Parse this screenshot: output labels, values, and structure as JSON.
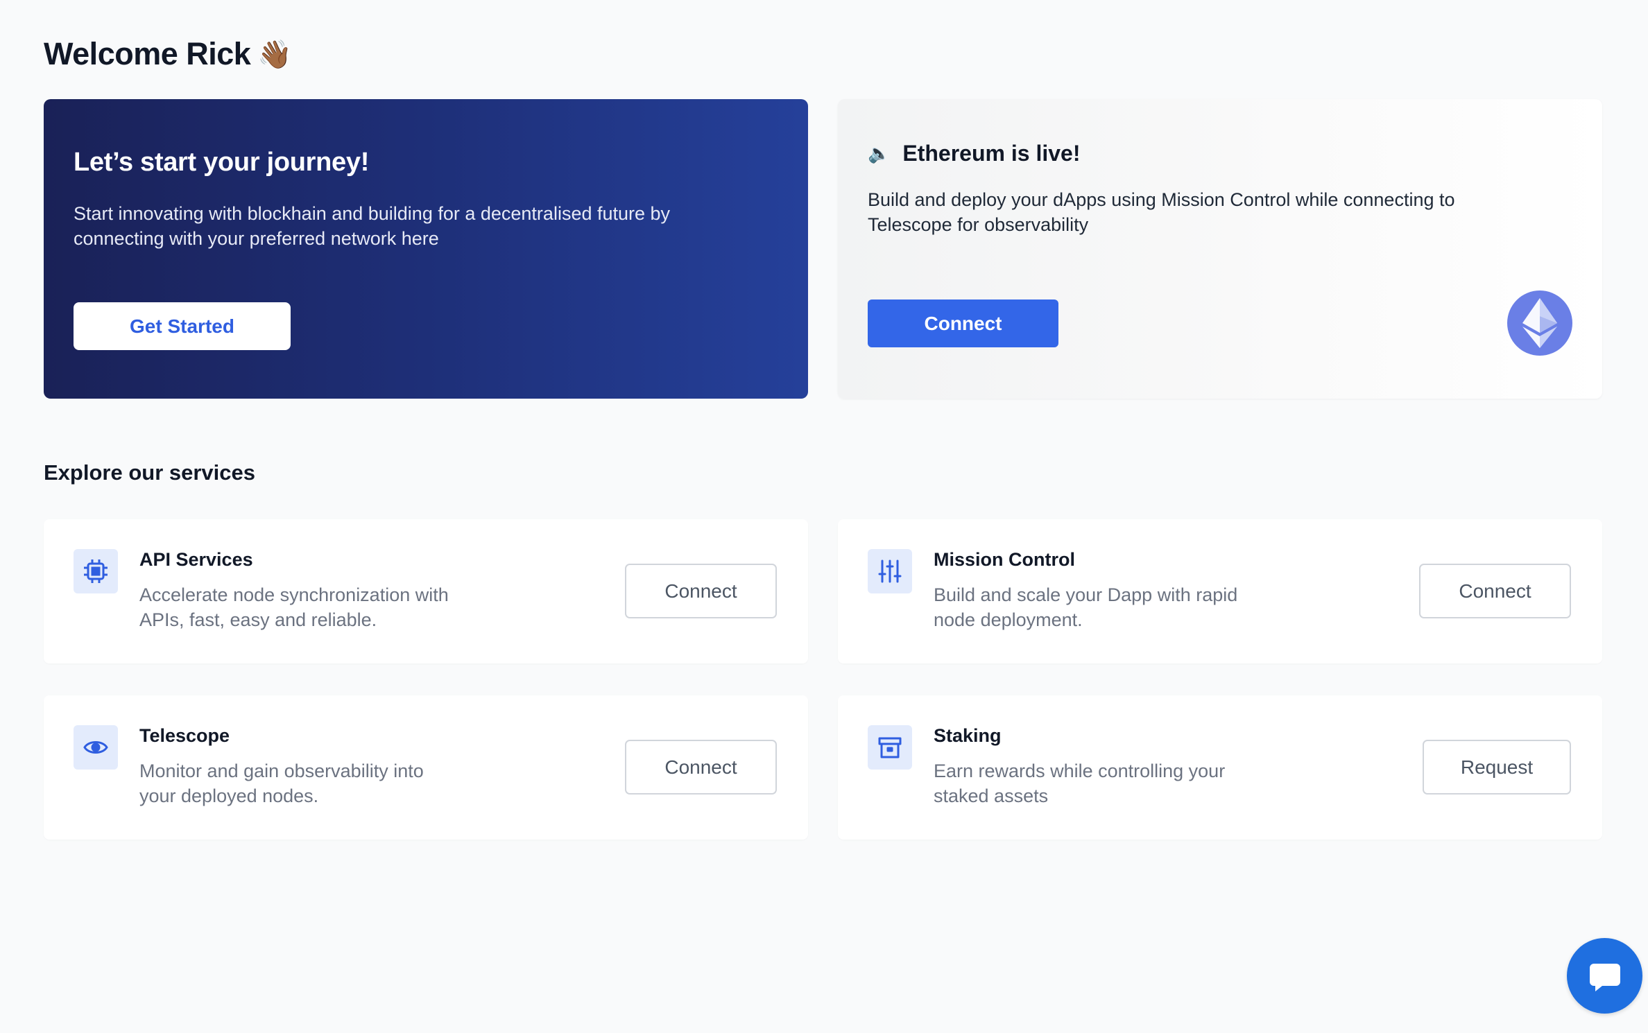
{
  "header": {
    "welcome": "Welcome Rick",
    "wave_emoji": "👋🏾"
  },
  "hero": {
    "title": "Let’s start your journey!",
    "text": "Start innovating with blockhain and building for a decentralised future by connecting with your preferred network here",
    "button_label": "Get Started"
  },
  "ethereum": {
    "icon": "speaker-icon",
    "speaker_emoji": "🔈",
    "title": "Ethereum is live!",
    "text": "Build and deploy your dApps using Mission Control while connecting to Telescope for observability",
    "button_label": "Connect",
    "logo": "ethereum-logo-icon"
  },
  "services": {
    "section_title": "Explore our services",
    "items": [
      {
        "icon": "chip-icon",
        "title": "API Services",
        "description": "Accelerate node synchronization with APIs, fast, easy and reliable.",
        "button_label": "Connect"
      },
      {
        "icon": "sliders-icon",
        "title": "Mission Control",
        "description": "Build and scale your Dapp with rapid node deployment.",
        "button_label": "Connect"
      },
      {
        "icon": "eye-icon",
        "title": "Telescope",
        "description": "Monitor and gain observability into your deployed nodes.",
        "button_label": "Connect"
      },
      {
        "icon": "archive-icon",
        "title": "Staking",
        "description": "Earn rewards while controlling your staked assets",
        "button_label": "Request"
      }
    ]
  },
  "chat": {
    "icon": "chat-bubble-icon"
  },
  "colors": {
    "primary": "#3366e8",
    "hero_dark": "#1a2157",
    "hero_light": "#25409a",
    "icon_bg": "#e3ebfc",
    "icon_fg": "#2f5ee0",
    "chat": "#1f6fe0"
  }
}
